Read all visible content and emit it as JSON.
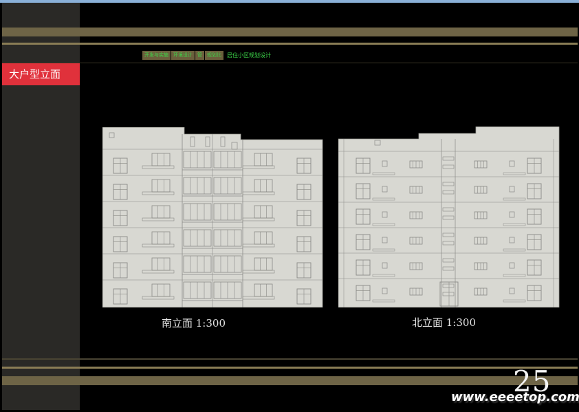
{
  "section_title": "大户型立面",
  "breadcrumbs": [
    "开发与实施",
    "环境设计",
    "管",
    "规划比",
    "居住小区规划设计"
  ],
  "captions": {
    "south": "南立面  1:300",
    "north": "北立面  1:300"
  },
  "page_number": "25",
  "watermark": "www.eeeetop.com",
  "colors": {
    "background": "#000000",
    "side_column": "#2a2926",
    "accent_band": "#6e6446",
    "title_tab": "#e0313b",
    "breadcrumb_text": "#3dd84a",
    "elevation_fill": "#d8d8d2"
  }
}
